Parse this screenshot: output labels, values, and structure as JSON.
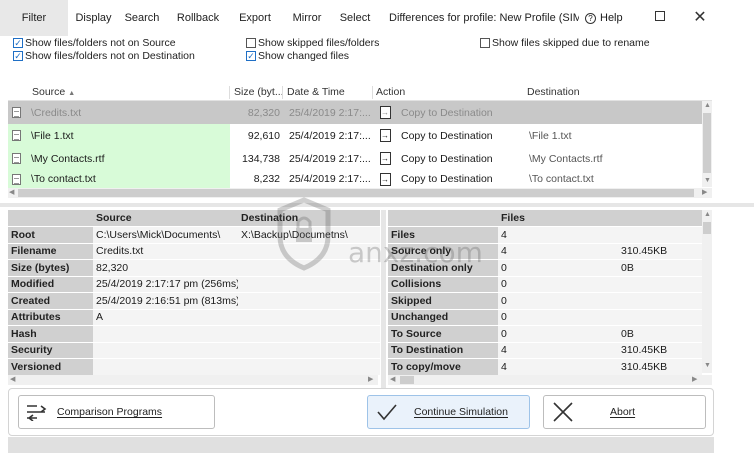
{
  "menu": {
    "filter": "Filter",
    "display": "Display",
    "search": "Search",
    "rollback": "Rollback",
    "export": "Export",
    "mirror": "Mirror",
    "select": "Select",
    "help": "Help"
  },
  "window_title": "Differences for profile: New Profile (SIM...",
  "filters": {
    "not_on_source": "Show files/folders not on Source",
    "not_on_destination": "Show files/folders not on Destination",
    "skipped": "Show skipped files/folders",
    "changed": "Show changed files",
    "rename": "Show files skipped due to rename"
  },
  "filter_state": {
    "not_on_source": true,
    "not_on_destination": true,
    "skipped": false,
    "changed": true,
    "rename": false
  },
  "grid": {
    "columns": [
      "Source",
      "Size (byt...",
      "Date & Time",
      "Action",
      "Destination"
    ],
    "rows": [
      {
        "source": "\\Credits.txt",
        "size": "82,320",
        "date": "25/4/2019 2:17:...",
        "action": "Copy to Destination",
        "destination": ""
      },
      {
        "source": "\\File 1.txt",
        "size": "92,610",
        "date": "25/4/2019 2:17:...",
        "action": "Copy to Destination",
        "destination": "\\File 1.txt"
      },
      {
        "source": "\\My Contacts.rtf",
        "size": "134,738",
        "date": "25/4/2019 2:17:...",
        "action": "Copy to Destination",
        "destination": "\\My Contacts.rtf"
      },
      {
        "source": "\\To contact.txt",
        "size": "8,232",
        "date": "25/4/2019 2:17:...",
        "action": "Copy to Destination",
        "destination": "\\To contact.txt"
      }
    ]
  },
  "details": {
    "header_source": "Source",
    "header_destination": "Destination",
    "rows": [
      {
        "label": "Root",
        "source": "C:\\Users\\Mick\\Documents\\",
        "destination": "X:\\Backup\\Documetns\\"
      },
      {
        "label": "Filename",
        "source": "Credits.txt",
        "destination": ""
      },
      {
        "label": "Size (bytes)",
        "source": "82,320",
        "destination": ""
      },
      {
        "label": "Modified",
        "source": "25/4/2019 2:17:17 pm (256ms)",
        "destination": ""
      },
      {
        "label": "Created",
        "source": "25/4/2019 2:16:51 pm (813ms)",
        "destination": ""
      },
      {
        "label": "Attributes",
        "source": "A",
        "destination": ""
      },
      {
        "label": "Hash",
        "source": "",
        "destination": ""
      },
      {
        "label": "Security",
        "source": "",
        "destination": ""
      },
      {
        "label": "Versioned",
        "source": "",
        "destination": ""
      }
    ]
  },
  "summary": {
    "header_files": "Files",
    "rows": [
      {
        "label": "Files",
        "files": "4",
        "size": ""
      },
      {
        "label": "Source only",
        "files": "4",
        "size": "310.45KB"
      },
      {
        "label": "Destination only",
        "files": "0",
        "size": "0B"
      },
      {
        "label": "Collisions",
        "files": "0",
        "size": ""
      },
      {
        "label": "Skipped",
        "files": "0",
        "size": ""
      },
      {
        "label": "Unchanged",
        "files": "0",
        "size": ""
      },
      {
        "label": "To Source",
        "files": "0",
        "size": "0B"
      },
      {
        "label": "To Destination",
        "files": "4",
        "size": "310.45KB"
      },
      {
        "label": "To copy/move",
        "files": "4",
        "size": "310.45KB"
      }
    ]
  },
  "buttons": {
    "compare": "Comparison Programs",
    "continue": "Continue Simulation",
    "abort": "Abort"
  },
  "watermark": "anxz.com",
  "colors": {
    "new_file_bg": "#d8fbd8",
    "selected_row_bg": "#c8c8c8",
    "accent": "#1f6fc5"
  }
}
